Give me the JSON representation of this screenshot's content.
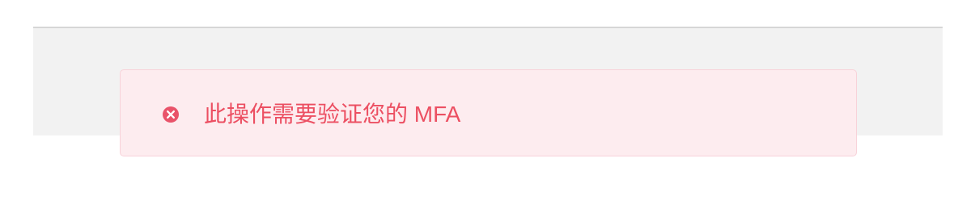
{
  "alert": {
    "type": "error",
    "icon": "close-circle-icon",
    "message": "此操作需要验证您的 MFA",
    "color": "#ec4f62",
    "background": "#fdecef"
  }
}
